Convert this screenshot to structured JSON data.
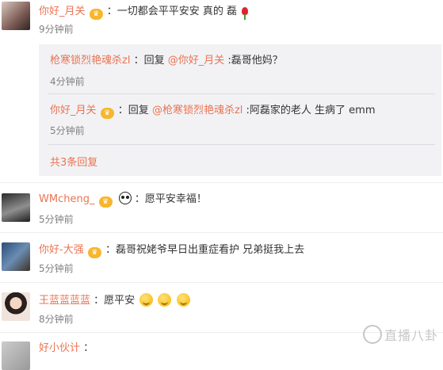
{
  "comments": [
    {
      "name": "你好_月关",
      "text": "：一切都会平平安安  真的  磊",
      "time": "9分钟前"
    },
    {
      "name": "WMcheng_",
      "text": "：愿平安幸福！",
      "time": "5分钟前"
    },
    {
      "name": "你好-大强",
      "text": "：磊哥祝姥爷早日出重症看护 兄弟挺我上去",
      "time": "5分钟前"
    },
    {
      "name": "王蓝蓝蓝蓝",
      "text": "：愿平安",
      "time": "8分钟前"
    },
    {
      "name": "好小伙计",
      "text": "："
    }
  ],
  "replies": [
    {
      "name": "枪寒锁烈艳魂杀zl",
      "text_prefix": "：回复",
      "mention": "@你好_月关",
      "text": ":磊哥他妈？",
      "time": "4分钟前"
    },
    {
      "name": "你好_月关",
      "text_prefix": "：回复",
      "mention": "@枪寒锁烈艳魂杀zl",
      "text": ":阿磊家的老人  生病了  emm",
      "time": "5分钟前"
    }
  ],
  "more_replies": "共3条回复",
  "badge_v": "V",
  "badge_vip": "♛",
  "watermark": "直播八卦",
  "icons": {
    "crown": "crown-icon",
    "panda": "panda-emoji-icon",
    "smile": "smile-emoji-icon",
    "rose": "rose-emoji-icon"
  },
  "colors": {
    "username": "#eb7350",
    "time": "#808080",
    "reply_bg": "#f2f2f5"
  }
}
